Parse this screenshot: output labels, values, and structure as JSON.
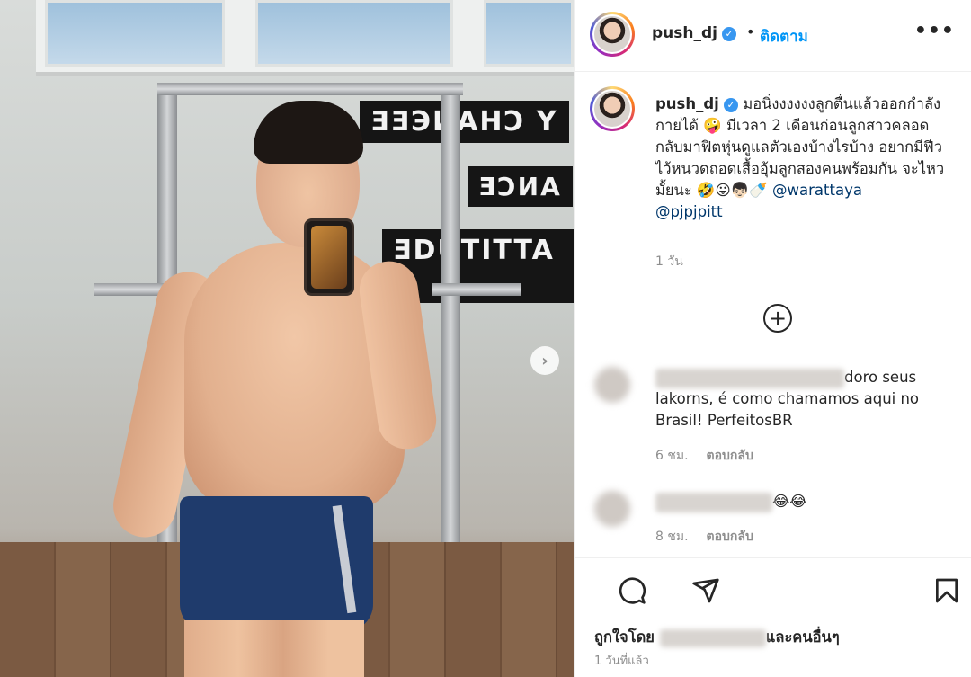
{
  "post": {
    "image_alt": "",
    "next_button": "›"
  },
  "header": {
    "username": "push_dj",
    "verified_mark": "✓",
    "dot": "•",
    "follow_label": "ติดตาม",
    "more_label": "•••"
  },
  "caption": {
    "username": "push_dj",
    "text": " มอนิ่งงงงงงลูกตื่นแล้วออกกำลังกายได้ 🤪 มีเวลา 2 เดือนก่อนลูกสาวคลอด กลับมาฟิตหุ่นดูแลตัวเองบ้างไรบ้าง อยากมีฟีวไว้หนวดถอดเสื้ออุ้มลูกสองคนพร้อมกัน จะไหวมั้ยนะ 🤣😛👦🏻🍼 ",
    "mention_1": "@warattaya",
    "mention_2": "@pjpjpitt",
    "time": "1 วัน"
  },
  "load_more": "+",
  "comments": [
    {
      "text_visible": "doro seus lakorns, é como chamamos aqui no Brasil! PerfeitosBR",
      "time": "6 ชม.",
      "reply_label": "ตอบกลับ"
    },
    {
      "text_visible": "😂😂",
      "time": "8 ชม.",
      "reply_label": "ตอบกลับ"
    }
  ],
  "likes": {
    "prefix": "ถูกใจโดย",
    "suffix": "และคนอื่นๆ"
  },
  "post_date": "1 วันที่แล้ว",
  "colors": {
    "link_blue": "#0095f6",
    "mention": "#00376b",
    "muted": "#8e8e8e",
    "text": "#262626"
  }
}
